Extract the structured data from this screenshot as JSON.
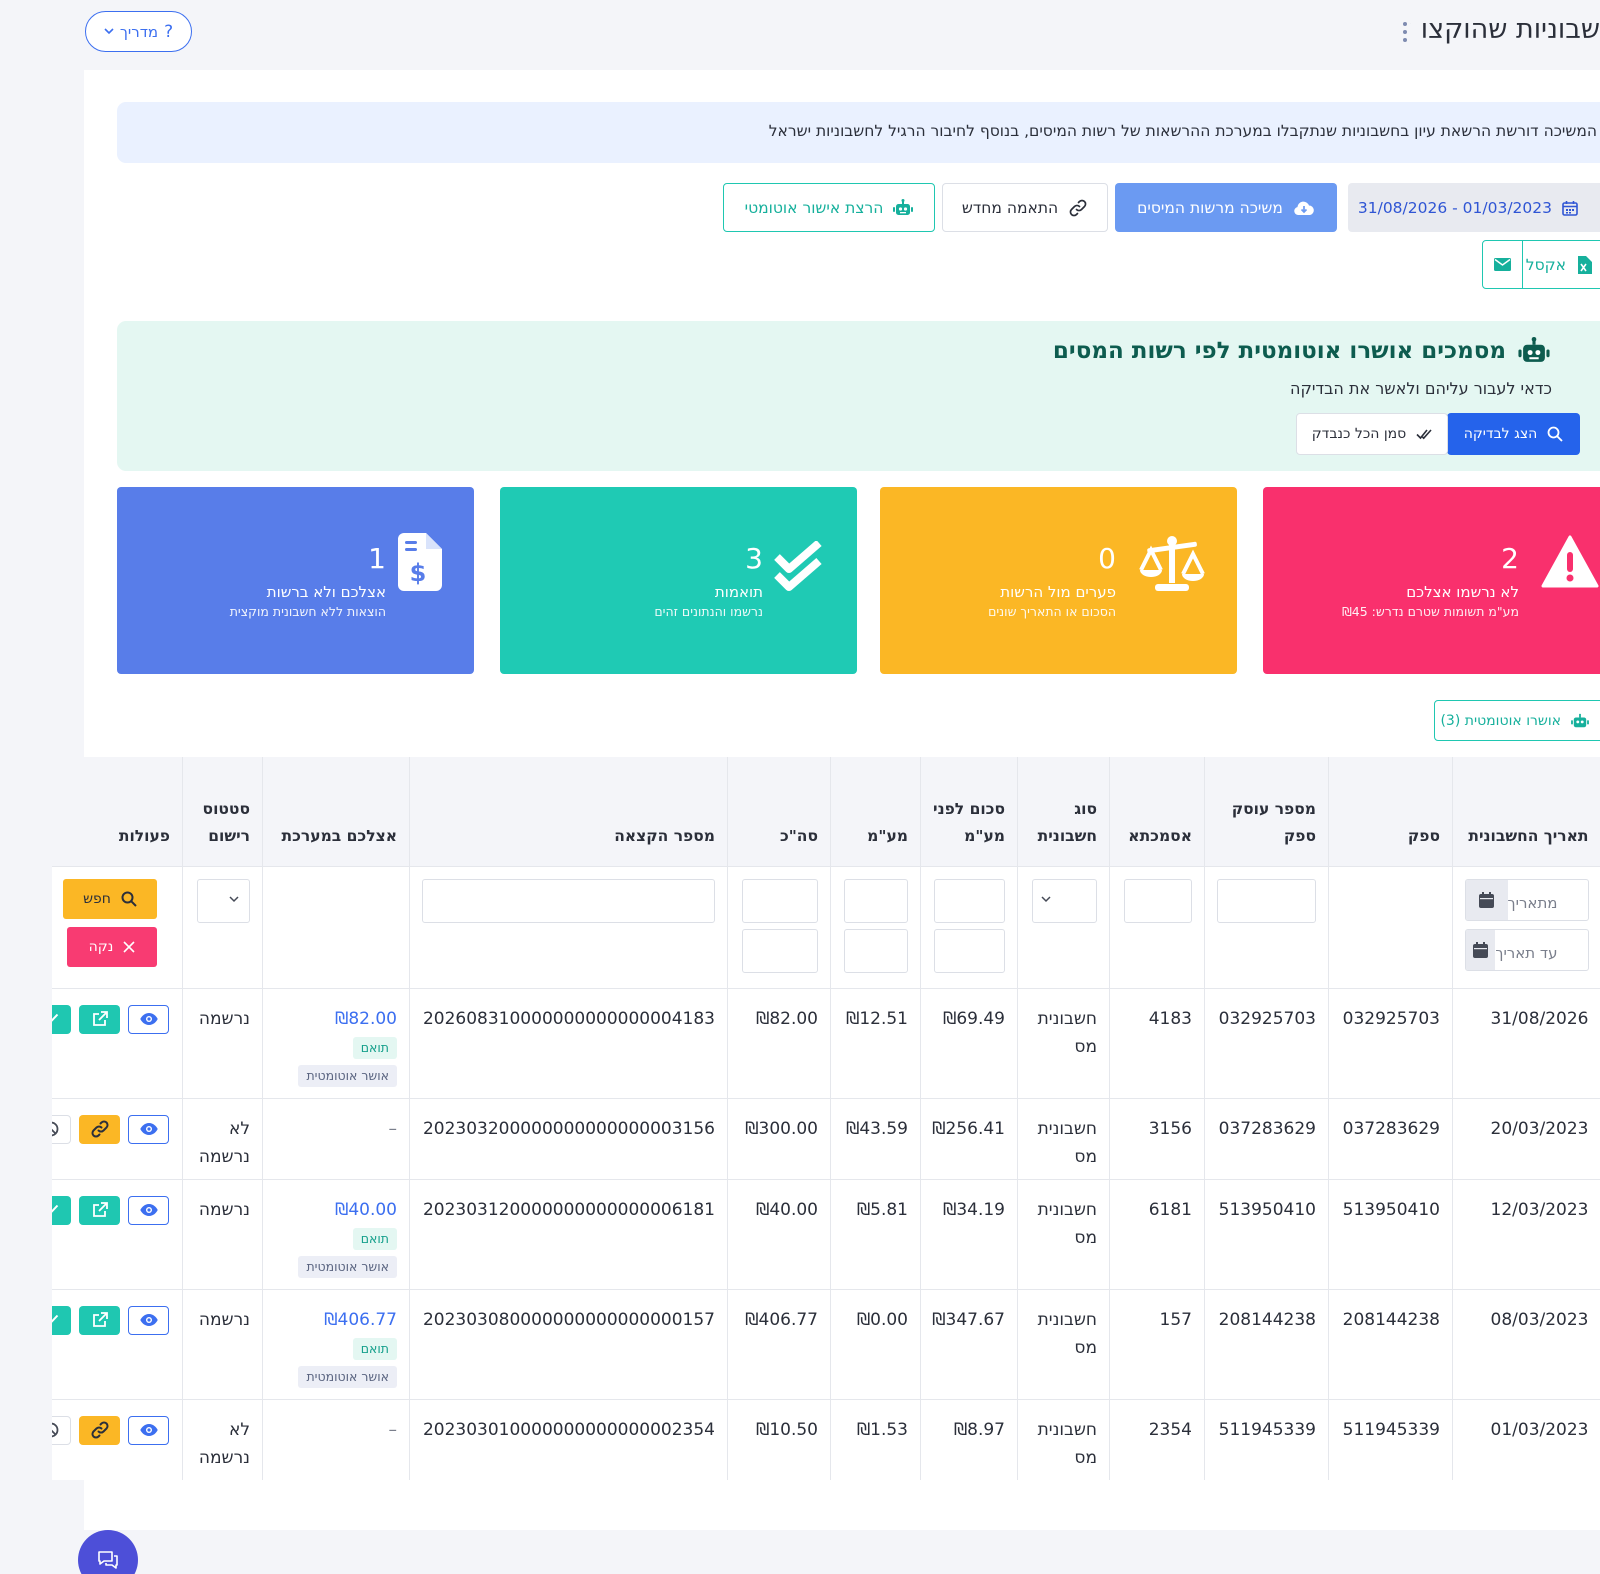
{
  "header": {
    "title": "שבוניות שהוקצו לי",
    "guide_label": "מדריך"
  },
  "banner": {
    "text": "המשיכה דורשת הרשאת עיון בחשבוניות שנתקבלו במערכת ההרשאות של רשות המיסים, בנוסף לחיבור הרגיל לחשבוניות ישראל"
  },
  "toolbar": {
    "date_range": "31/08/2026 - 01/03/2023",
    "pull_label": "משיכה מרשות המיסים",
    "rematch_label": "התאמה מחדש",
    "auto_approve_label": "הרצת אישור אוטומטי",
    "excel_label": "אקסל"
  },
  "auto_banner": {
    "title": "מסמכים אושרו אוטומטית לפי רשות המסים",
    "subtitle": "כדאי לעבור עליהם ולאשר את הבדיקה",
    "show_label": "הצג לבדיקה",
    "mark_label": "סמן הכל כנבדק"
  },
  "cards": [
    {
      "value": "2",
      "label": "לא נרשמו אצלכם",
      "sub": "מע\"מ תשומות שטרם נדרש: ₪45",
      "color": "#f9306d",
      "icon": "warning-icon"
    },
    {
      "value": "0",
      "label": "פערים מול הרשות",
      "sub": "הסכום או התאריך שונים",
      "color": "#fbb725",
      "icon": "scale-icon"
    },
    {
      "value": "3",
      "label": "תואמות",
      "sub": "נרשמו והנתונים זהים",
      "color": "#1fcab4",
      "icon": "double-check-icon"
    },
    {
      "value": "1",
      "label": "אצלכם ולא ברשות",
      "sub": "הוצאות ללא חשבונית מוקצית",
      "color": "#587de9",
      "icon": "invoice-dollar-icon"
    }
  ],
  "auto_filter_label": "אושרו אוטומטית (3)",
  "table": {
    "headers": [
      "תאריך החשבונית",
      "ספק",
      "מספר עוסק ספק",
      "אסמכתא",
      "סוג חשבונית",
      "סכום לפני מע\"מ",
      "מע\"מ",
      "סה\"כ",
      "מספר הקצאה",
      "אצלכם במערכת",
      "סטטוס רישום",
      "פעולות"
    ],
    "filters": {
      "date_from_placeholder": "מתאריך",
      "date_to_placeholder": "עד תאריך",
      "search_label": "חפש",
      "clear_label": "נקה"
    },
    "rows": [
      {
        "date": "31/08/2026",
        "supplier": "032925703",
        "supplier_id": "032925703",
        "reference": "4183",
        "type": "חשבונית מס",
        "before_vat": "₪69.49",
        "vat": "₪12.51",
        "total": "₪82.00",
        "allocation": "202608310000000000000004183",
        "system_amount": "₪82.00",
        "match_badge": "תואם",
        "auto_badge": "אושר אוטומטית",
        "status": "נרשמה"
      },
      {
        "date": "20/03/2023",
        "supplier": "037283629",
        "supplier_id": "037283629",
        "reference": "3156",
        "type": "חשבונית מס",
        "before_vat": "₪256.41",
        "vat": "₪43.59",
        "total": "₪300.00",
        "allocation": "202303200000000000000003156",
        "system_amount": "–",
        "match_badge": "",
        "auto_badge": "",
        "status": "לא נרשמה"
      },
      {
        "date": "12/03/2023",
        "supplier": "513950410",
        "supplier_id": "513950410",
        "reference": "6181",
        "type": "חשבונית מס",
        "before_vat": "₪34.19",
        "vat": "₪5.81",
        "total": "₪40.00",
        "allocation": "202303120000000000000006181",
        "system_amount": "₪40.00",
        "match_badge": "תואם",
        "auto_badge": "אושר אוטומטית",
        "status": "נרשמה"
      },
      {
        "date": "08/03/2023",
        "supplier": "208144238",
        "supplier_id": "208144238",
        "reference": "157",
        "type": "חשבונית מס",
        "before_vat": "₪347.67",
        "vat": "₪0.00",
        "total": "₪406.77",
        "allocation": "202303080000000000000000157",
        "system_amount": "₪406.77",
        "match_badge": "תואם",
        "auto_badge": "אושר אוטומטית",
        "status": "נרשמה"
      },
      {
        "date": "01/03/2023",
        "supplier": "511945339",
        "supplier_id": "511945339",
        "reference": "2354",
        "type": "חשבונית מס",
        "before_vat": "₪8.97",
        "vat": "₪1.53",
        "total": "₪10.50",
        "allocation": "202303010000000000000002354",
        "system_amount": "–",
        "match_badge": "",
        "auto_badge": "",
        "status": "לא נרשמה"
      }
    ]
  }
}
